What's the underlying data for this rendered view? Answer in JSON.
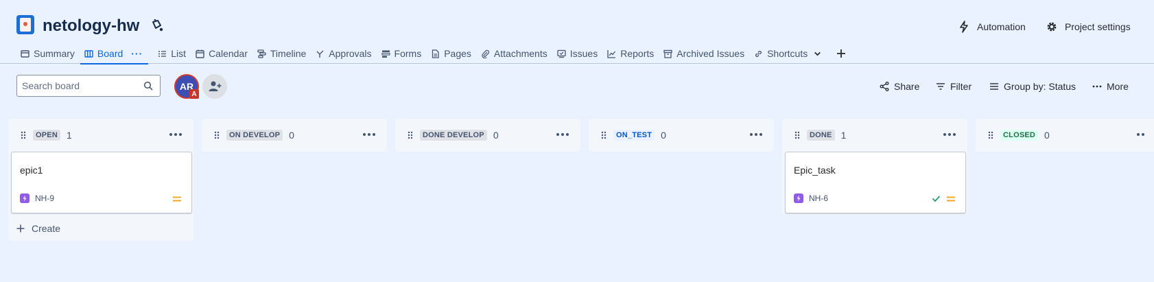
{
  "header": {
    "project_name": "netology-hw",
    "automation_label": "Automation",
    "settings_label": "Project settings"
  },
  "tabs": [
    {
      "label": "Summary",
      "icon": "summary-icon"
    },
    {
      "label": "Board",
      "icon": "board-icon",
      "active": true
    },
    {
      "label": "List",
      "icon": "list-icon"
    },
    {
      "label": "Calendar",
      "icon": "calendar-icon"
    },
    {
      "label": "Timeline",
      "icon": "timeline-icon"
    },
    {
      "label": "Approvals",
      "icon": "approvals-icon"
    },
    {
      "label": "Forms",
      "icon": "forms-icon"
    },
    {
      "label": "Pages",
      "icon": "pages-icon"
    },
    {
      "label": "Attachments",
      "icon": "paperclip-icon"
    },
    {
      "label": "Issues",
      "icon": "issues-icon"
    },
    {
      "label": "Reports",
      "icon": "reports-icon"
    },
    {
      "label": "Archived Issues",
      "icon": "archive-icon"
    },
    {
      "label": "Shortcuts",
      "icon": "link-icon"
    }
  ],
  "toolbar": {
    "search_placeholder": "Search board",
    "avatar_initials": "AR",
    "avatar_badge": "A",
    "share_label": "Share",
    "filter_label": "Filter",
    "group_label": "Group by: Status",
    "more_label": "More"
  },
  "columns": [
    {
      "status": "OPEN",
      "count": "1",
      "style": "gray",
      "cards": [
        {
          "title": "epic1",
          "key": "NH-9",
          "priority": "medium",
          "done": false
        }
      ],
      "create_label": "Create"
    },
    {
      "status": "ON DEVELOP",
      "count": "0",
      "style": "gray",
      "cards": []
    },
    {
      "status": "DONE DEVELOP",
      "count": "0",
      "style": "gray",
      "cards": []
    },
    {
      "status": "ON_TEST",
      "count": "0",
      "style": "blue",
      "cards": []
    },
    {
      "status": "DONE",
      "count": "1",
      "style": "gray",
      "cards": [
        {
          "title": "Epic_task",
          "key": "NH-6",
          "priority": "medium",
          "done": true
        }
      ]
    },
    {
      "status": "CLOSED",
      "count": "0",
      "style": "green",
      "cards": []
    }
  ],
  "colors": {
    "background": "#e9f2fe",
    "accent": "#0c66e4",
    "epic": "#8f5be8",
    "priority_medium": "#f5a623",
    "done_check": "#22a06b"
  }
}
